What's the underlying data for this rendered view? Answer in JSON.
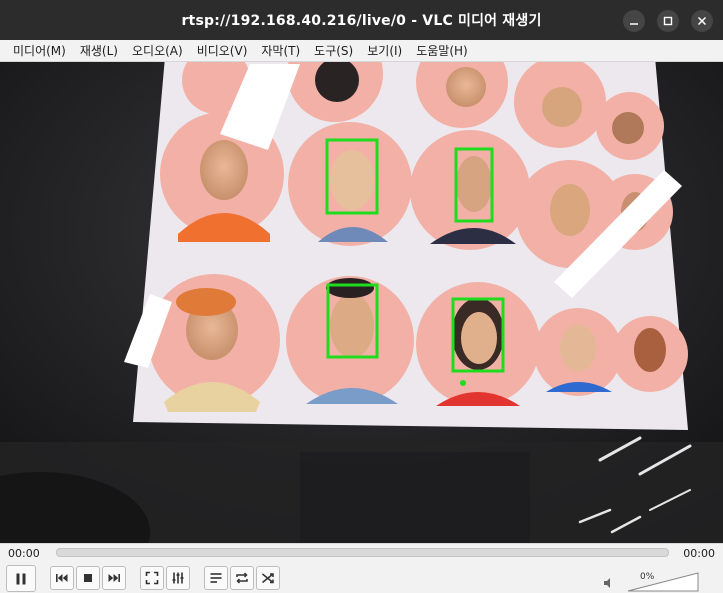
{
  "window": {
    "title": "rtsp://192.168.40.216/live/0 - VLC 미디어 재생기"
  },
  "menu": {
    "items": [
      "미디어(M)",
      "재생(L)",
      "오디오(A)",
      "비디오(V)",
      "자막(T)",
      "도구(S)",
      "보기(I)",
      "도움말(H)"
    ]
  },
  "player": {
    "elapsed": "00:00",
    "total": "00:00",
    "progress": 0,
    "volume": "0%",
    "volume_level": 0
  },
  "icons": {
    "minimize": "minimize-icon",
    "maximize": "maximize-icon",
    "close": "close-icon",
    "pause": "pause-icon",
    "prev": "previous-icon",
    "stop": "stop-icon",
    "next": "next-icon",
    "fullscreen": "fullscreen-icon",
    "ext_settings": "equalizer-icon",
    "playlist": "playlist-icon",
    "loop": "loop-icon",
    "shuffle": "shuffle-icon",
    "speaker": "speaker-muted-icon"
  },
  "colors": {
    "detection_box": "#1fdc1f",
    "poster": "#e9e5ea",
    "face_circle": "#f3b0a6"
  }
}
